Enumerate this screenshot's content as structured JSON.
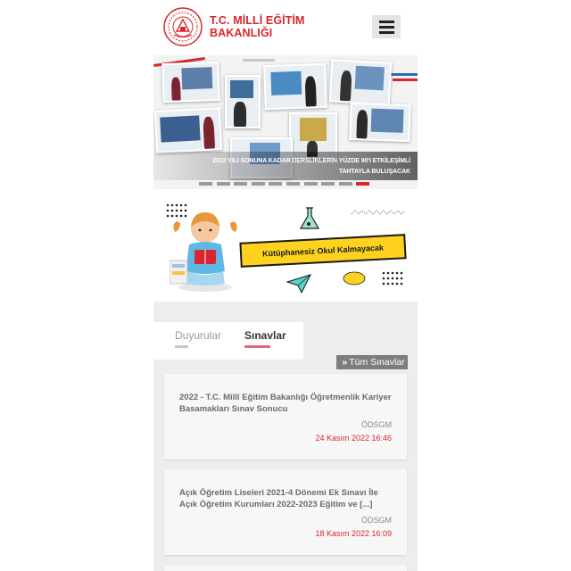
{
  "header": {
    "logo_line1": "T.C. MİLLİ EĞİTİM",
    "logo_line2": "BAKANLIĞI",
    "menu_icon": "hamburger-icon",
    "brand_color": "#d7262e"
  },
  "slider": {
    "caption_line1": "2022 YILI SONUNA KADAR DERSLİKLERİN YÜZDE 90'I ETKİLEŞİMLİ",
    "caption_line2": "TAHTAYLA BULUŞACAK",
    "slide_count": 10,
    "active_slide": 9
  },
  "banner": {
    "text": "Kütüphanesiz Okul Kalmayacak"
  },
  "announcements": {
    "tabs": [
      {
        "label": "Duyurular",
        "active": false
      },
      {
        "label": "Sınavlar",
        "active": true
      }
    ],
    "all_link": "Tüm Sınavlar",
    "all_link_icon": "double-chevron-right-icon",
    "items": [
      {
        "title": "2022 - T.C. Millî Eğitim Bakanlığı Öğretmenlik Kariyer Basamakları Sınav Sonucu",
        "source": "ÖDSGM",
        "date": "24 Kasım 2022 16:46"
      },
      {
        "title": "Açık Öğretim Liseleri 2021-4 Dönemi Ek Sınavı İle Açık Öğretim Kurumları 2022-2023 Eğitim ve [...]",
        "source": "ÖDSGM",
        "date": "18 Kasım 2022 16:09"
      }
    ]
  }
}
